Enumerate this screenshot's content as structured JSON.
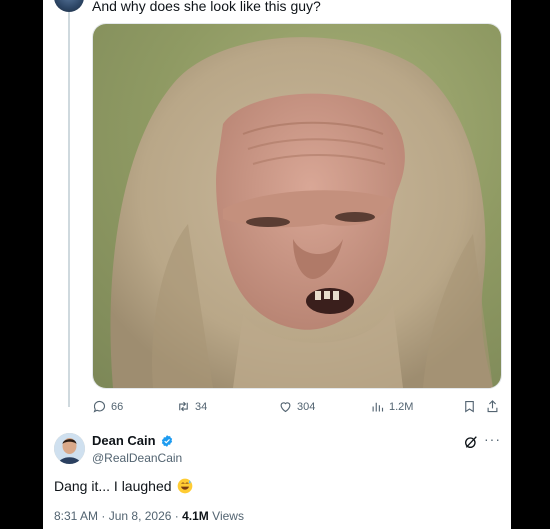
{
  "tweet": {
    "text": "And why does she look like this guy?",
    "image_alt": "",
    "stats": {
      "replies": "66",
      "reposts": "34",
      "likes": "304",
      "views": "1.2M"
    }
  },
  "reply": {
    "name": "Dean Cain",
    "handle": "@RealDeanCain",
    "text": "Dang it... I laughed",
    "time": "8:31 AM",
    "separator1": "·",
    "date": "Jun 8, 2026",
    "separator2": "·",
    "views_count": "4.1M",
    "views_label": "Views"
  },
  "colors": {
    "text_primary": "#0f1419",
    "text_secondary": "#536471",
    "verified_blue": "#1d9bf0",
    "thread_line": "#cfd9de"
  }
}
